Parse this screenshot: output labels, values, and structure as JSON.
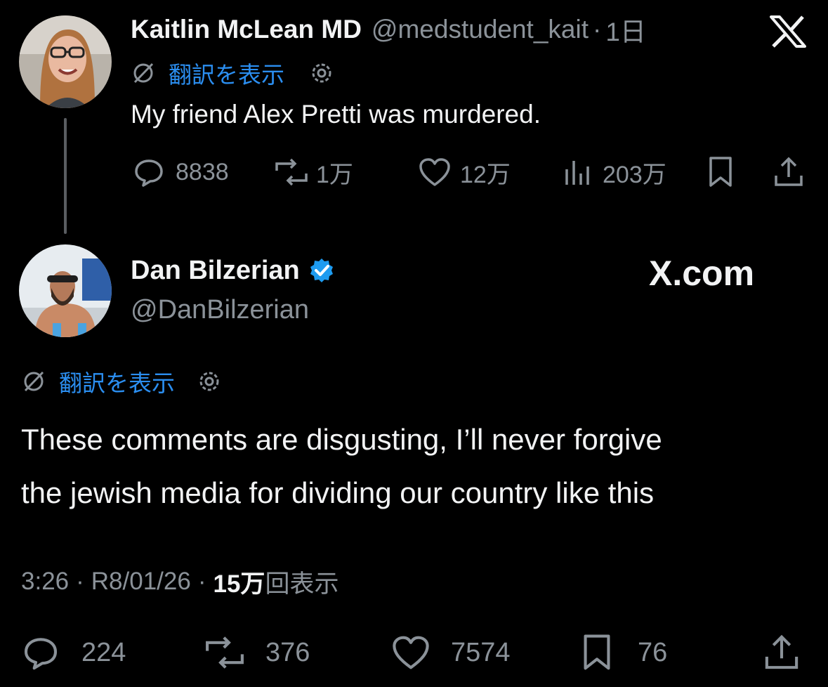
{
  "parent": {
    "display_name": "Kaitlin McLean MD",
    "handle": "@medstudent_kait",
    "time": "1日",
    "translate_label": "翻訳を表示",
    "text": "My friend Alex Pretti was murdered.",
    "stats": {
      "replies": "8838",
      "reposts": "1万",
      "likes": "12万",
      "views": "203万"
    }
  },
  "reply": {
    "display_name": "Dan Bilzerian",
    "handle": "@DanBilzerian",
    "verified": true,
    "translate_label": "翻訳を表示",
    "text_line1": "These comments are disgusting, I’ll never forgive",
    "text_line2": "the jewish media for dividing our country like this",
    "time": "3:26",
    "date": "R8/01/26",
    "views_count": "15万",
    "views_label": "回表示",
    "stats": {
      "replies": "224",
      "reposts": "376",
      "likes": "7574",
      "bookmarks": "76"
    }
  },
  "watermark": {
    "text": "X.com"
  },
  "colors": {
    "background": "#000000",
    "link": "#2b8ef0",
    "verified": "#1d9bf0",
    "muted": "#8b9299"
  },
  "icons": [
    "x-logo-icon",
    "translate-icon",
    "gear-icon",
    "reply-icon",
    "repost-icon",
    "like-icon",
    "views-icon",
    "bookmark-icon",
    "share-icon",
    "verified-badge-icon"
  ]
}
